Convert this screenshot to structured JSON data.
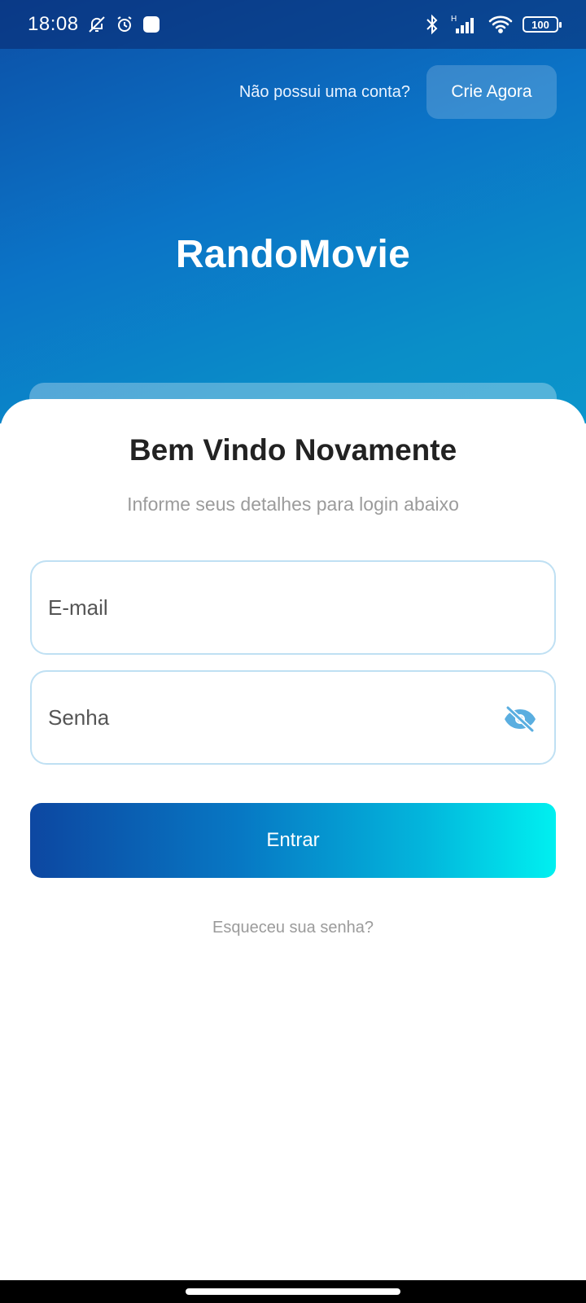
{
  "status_bar": {
    "time": "18:08",
    "battery": "100",
    "network_label": "H",
    "icons": [
      "bell-off-icon",
      "alarm-icon",
      "notification-square-icon",
      "bluetooth-icon",
      "signal-icon",
      "wifi-icon",
      "battery-icon"
    ]
  },
  "header": {
    "prompt_text": "Não possui uma conta?",
    "signup_button": "Crie Agora"
  },
  "brand": {
    "app_name": "RandoMovie"
  },
  "login_card": {
    "title": "Bem Vindo Novamente",
    "subtitle": "Informe seus detalhes para login abaixo",
    "email_placeholder": "E-mail",
    "password_placeholder": "Senha",
    "password_toggle_icon": "eye-off-icon",
    "submit_button": "Entrar",
    "forgot_link": "Esqueceu sua senha?"
  },
  "colors": {
    "header_gradient_start": "#0d4fa6",
    "header_gradient_end": "#0b95cc",
    "button_gradient_start": "#0d47a1",
    "button_gradient_end": "#00f0f0",
    "field_border": "#bfe0f3",
    "eye_icon": "#5aaee0"
  }
}
